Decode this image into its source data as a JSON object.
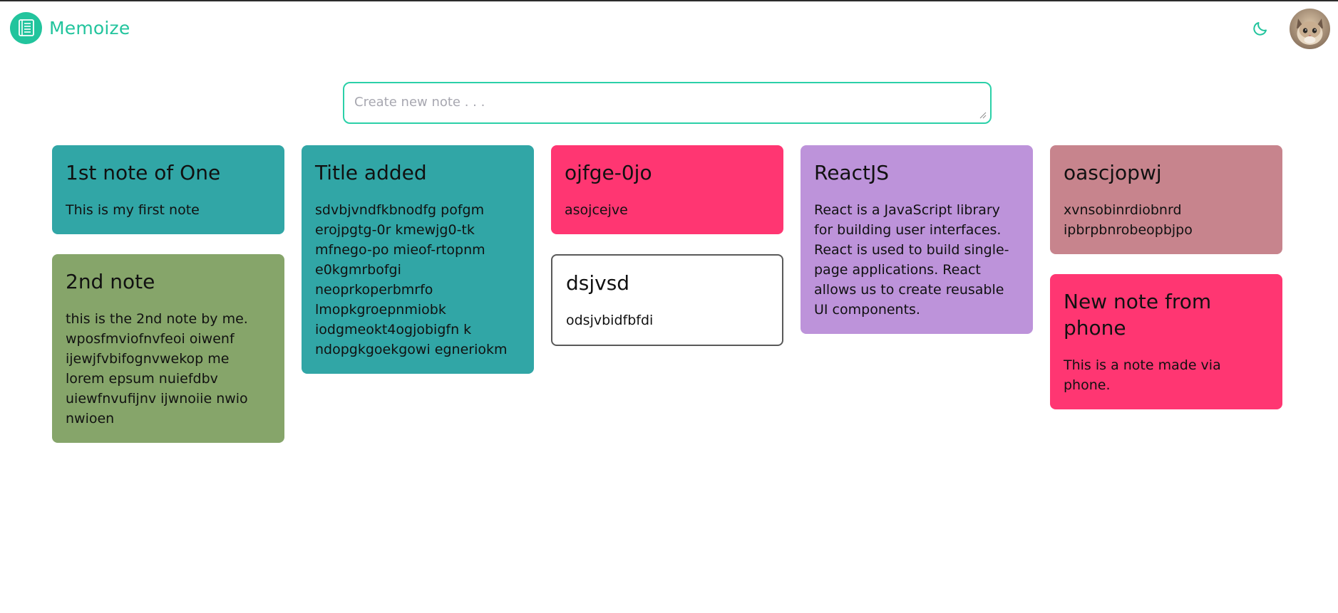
{
  "app": {
    "name": "Memoize",
    "brand_color": "#22c49d"
  },
  "header": {
    "logo_icon": "notebook-list-icon",
    "theme_toggle_icon": "moon-icon",
    "avatar_alt": "cat-avatar"
  },
  "composer": {
    "placeholder": "Create new note . . .",
    "value": ""
  },
  "notes": {
    "col1": [
      {
        "title": "1st note of One",
        "body": "This is my first note",
        "color": "#31a6a6"
      },
      {
        "title": "2nd note",
        "body": "this is the 2nd note by me. wposfmviofnvfeoi oiwenf ijewjfvbifognvwekop me lorem epsum nuiefdbv uiewfnvufijnv ijwnoiie nwio nwioen",
        "color": "#86a56a"
      }
    ],
    "col2": [
      {
        "title": "Title added",
        "body": "sdvbjvndfkbnodfg pofgm erojpgtg-0r kmewjg0-tk mfnego-po mieof-rtopnm e0kgmrbofgi neoprkoperbmrfo lmopkgroepnmiobk iodgmeokt4ogjobigfn k ndopgkgoekgowi egneriokm",
        "color": "#31a6a6"
      }
    ],
    "col3": [
      {
        "title": "ojfge-0jo",
        "body": "asojcejve",
        "color": "#ff3672"
      },
      {
        "title": "dsjvsd",
        "body": "odsjvbidfbfdi",
        "color": "#ffffff"
      }
    ],
    "col4": [
      {
        "title": "ReactJS",
        "body": "React is a JavaScript library for building user interfaces. React is used to build single-page applications. React allows us to create reusable UI components.",
        "color": "#bd93da"
      }
    ],
    "col5": [
      {
        "title": "oascjopwj",
        "body": "xvnsobinrdiobnrd ipbrpbnrobeopbjpo",
        "color": "#c7848d"
      },
      {
        "title": "New note from phone",
        "body": "This is a note made via phone.",
        "color": "#ff3672"
      }
    ]
  }
}
